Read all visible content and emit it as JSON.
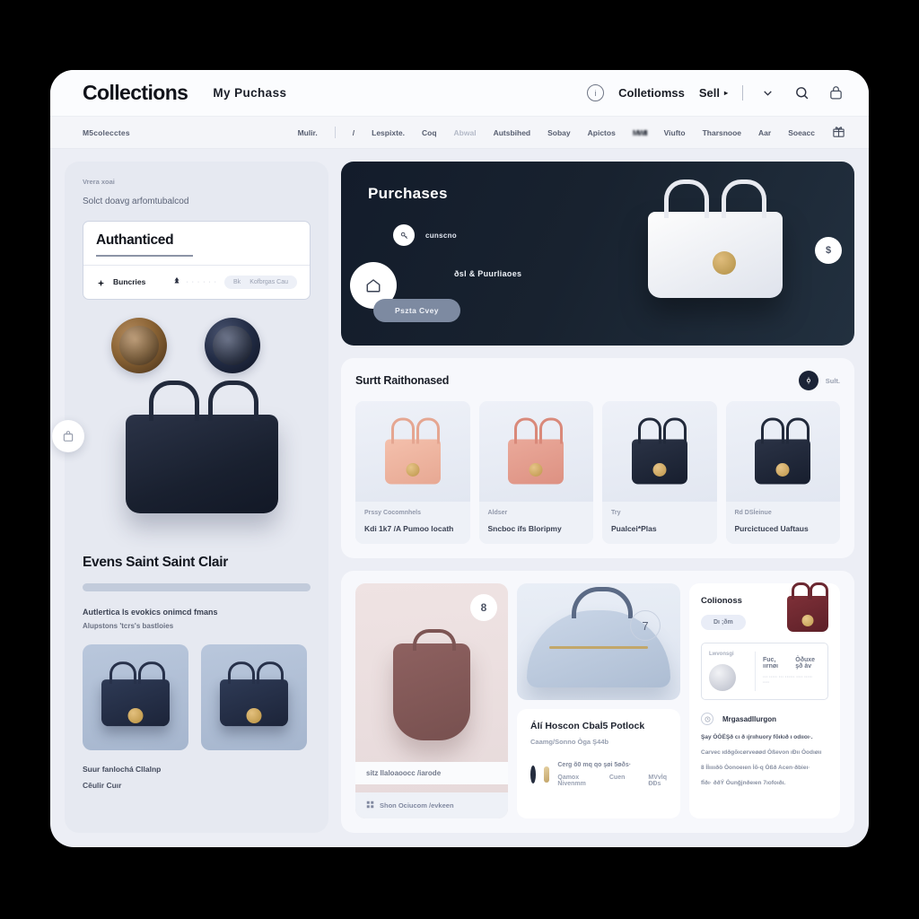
{
  "header": {
    "brand": "Collections",
    "sub_nav": "My  Puchass",
    "right": {
      "info_icon": "info-circle-icon",
      "collections_link": "Colletiomss",
      "sell_link": "Sell",
      "sell_caret": "▸",
      "chevron_icon": "chevron-down-icon",
      "search_icon": "search-icon",
      "bag_icon": "lock-bag-icon"
    }
  },
  "navstrip": {
    "left_label": "M5colecctes",
    "items": [
      "Mulir.",
      "/",
      "Lespixte.",
      "Coq",
      "Abwal",
      "Autsbihed",
      "Sobay",
      "Apictos",
      "MWII",
      "Viufto",
      "Tharsnooe",
      "Aar",
      "Soeacc"
    ],
    "gift_icon": "gift-icon"
  },
  "sidebar": {
    "eyebrow": "Vrera xoai",
    "subtitle": "Solct doavg arfomtubalcod",
    "auth_card": {
      "title": "Authanticed",
      "footer_label": "Buncries",
      "footer_icon": "sparkle-icon",
      "mid_icon": "tree-pin-icon",
      "mid_faint": "· · · · · ·",
      "pill_left": "Bk",
      "pill_right": "Kofbrgas  Cau"
    },
    "medals": [
      {
        "name": "bronze-medallion"
      },
      {
        "name": "navy-medallion"
      }
    ],
    "float_button_icon": "bag-icon",
    "product_title": "Evens Saint Saint Clair",
    "progress_percent": 100,
    "line1": "Autlertica ls evokics onimcd fmans",
    "line2": "Alupstons 'tcrs's bastloies",
    "thumbnails": [
      {
        "name": "navy-tote-thumb"
      },
      {
        "name": "navy-boxbag-thumb"
      }
    ],
    "foot1": "Suur fanlochá Cllalnp",
    "foot2": "Cêulir Cuır"
  },
  "hero": {
    "title": "Purchases",
    "row1_label": "cunscno",
    "row1_icon": "key-icon",
    "row2_label": "ðsl & Puurliaoes",
    "row2_icon": "home-icon",
    "cta_label": "Pszta Cvey",
    "right_button": "$",
    "bag_image": "white-handbag"
  },
  "suit_section": {
    "title": "Surtt Raithonased",
    "badge_icon": "filter-dot-icon",
    "badge_label": "Sult.",
    "cards": [
      {
        "image": "peach-tote",
        "k": "Prssy Cocomnhels",
        "v": "Kdi 1k7 /A Pumoo locath"
      },
      {
        "image": "rose-woven-tote",
        "k": "Aldser",
        "v": "Sncboc ífs Bloripmy"
      },
      {
        "image": "navy-tote",
        "k": "Try",
        "v": "Pualcei*Plas"
      },
      {
        "image": "navy-woven-tote",
        "k": "Rd DSÍeinue",
        "v": "Purcictuced Uaftaus"
      }
    ]
  },
  "bottom": {
    "tall_card": {
      "badge": "8",
      "image": "brown-bucket-bag",
      "caption": "sitz Ilaloaoocc /iarode",
      "footer": "Shon Ociucom /evkeen",
      "footer_icon": "grid-icon"
    },
    "mid_card": {
      "image": "blue-marble-bowling-bag",
      "ring_label": "7",
      "title": "ÁIí Hoscon Cbaİ5 Potlock",
      "subtitle": "Caamg/Sonno Òga  Ş44b",
      "row_icon_dark": "avatar-icon",
      "row_icon_gold": "gold-clasp-icon",
      "row_line1": "Cerg  õ0 mq  qo  şøi  5øðs·",
      "row_line2_a": "Qamox Nivenmm",
      "row_line2_b": "Cuen",
      "row_line2_c": "MVvİq ÐÐs"
    },
    "right_card": {
      "title": "Colionoss",
      "pill": "Dı  ;ðm",
      "bag_image": "burgundy-tote",
      "sub_label": "Lwvonsgi",
      "coin_icon": "silver-coin",
      "sub_r1_a": "Fuc, ıırnøı",
      "sub_r1_b": "Òðuxe şð àv",
      "sub_r2": "···  ·····  ···  ······  ····  ····· ····",
      "section_icon": "clock-icon",
      "section_title": "Mrgasadllurgоn",
      "p1": "Şay ÒÒËŞð cı ð ıjrııhuory fõıkıð ı odııoı·.",
      "p2": "Carvec ıdðgõıcørveøød Òßevon ıÐıı Òodıøıı",
      "p3": "8 İİııııðö Òonoeıen İõ-q Òßð Acen·ðbieı·",
      "p4": "fİðı· ððÝ Òunğjnðeıen 7ıofoıðı."
    }
  }
}
